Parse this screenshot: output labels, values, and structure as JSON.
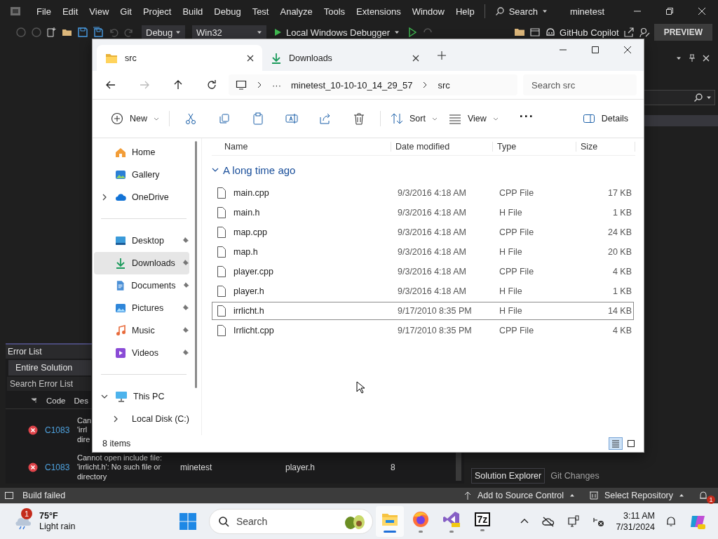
{
  "vs": {
    "menu": [
      "File",
      "Edit",
      "View",
      "Git",
      "Project",
      "Build",
      "Debug",
      "Test",
      "Analyze",
      "Tools",
      "Extensions",
      "Window",
      "Help"
    ],
    "search": "Search",
    "solution_name": "minetest",
    "toolbar": {
      "configuration": "Debug",
      "platform": "Win32",
      "debugger": "Local Windows Debugger",
      "copilot": "GitHub Copilot",
      "preview": "PREVIEW"
    },
    "error_list": {
      "title": "Error List",
      "scope": "Entire Solution",
      "search_placeholder": "Search Error List",
      "columns": [
        "Code",
        "Des"
      ],
      "rows": [
        {
          "code": "C1083",
          "description": "Can\n'irrl\ndire"
        },
        {
          "code": "C1083",
          "description": "Cannot open include file:\n'irrlicht.h': No such file or\ndirectory",
          "project": "minetest",
          "file": "player.h",
          "line": "8"
        }
      ]
    },
    "side_tabs": [
      {
        "label": "Solution Explorer",
        "selected": true
      },
      {
        "label": "Git Changes",
        "selected": false
      }
    ],
    "status_bar": {
      "build": "Build failed",
      "source_control": "Add to Source Control",
      "repository": "Select Repository",
      "notifications": "1"
    }
  },
  "explorer": {
    "tabs": [
      {
        "label": "src",
        "kind": "folder",
        "selected": true
      },
      {
        "label": "Downloads",
        "kind": "download",
        "selected": false
      }
    ],
    "address": {
      "overflow": "···",
      "segments": [
        "minetest_10-10-10_14_29_57",
        "src"
      ]
    },
    "search_placeholder": "Search src",
    "commands": {
      "new": "New",
      "sort": "Sort",
      "view": "View",
      "more": "···",
      "details": "Details"
    },
    "nav_groups": [
      [
        {
          "label": "Home",
          "kind": "home",
          "selected": false
        },
        {
          "label": "Gallery",
          "kind": "gallery",
          "selected": false
        },
        {
          "label": "OneDrive",
          "kind": "cloud",
          "selected": false,
          "expanded": false
        }
      ],
      [
        {
          "label": "Desktop",
          "kind": "desktop",
          "selected": false,
          "pinned": true
        },
        {
          "label": "Downloads",
          "kind": "download",
          "selected": true,
          "pinned": true
        },
        {
          "label": "Documents",
          "kind": "documents",
          "selected": false,
          "pinned": true
        },
        {
          "label": "Pictures",
          "kind": "pictures",
          "selected": false,
          "pinned": true
        },
        {
          "label": "Music",
          "kind": "music",
          "selected": false,
          "pinned": true
        },
        {
          "label": "Videos",
          "kind": "videos",
          "selected": false,
          "pinned": true
        }
      ],
      [
        {
          "label": "This PC",
          "kind": "pc",
          "selected": false,
          "expanded": true,
          "children": [
            {
              "label": "Local Disk (C:)",
              "kind": "disk",
              "selected": false,
              "expanded": false
            }
          ]
        }
      ]
    ],
    "columns": [
      "Name",
      "Date modified",
      "Type",
      "Size"
    ],
    "group": {
      "label": "A long time ago",
      "expanded": true
    },
    "files": [
      {
        "name": "main.cpp",
        "date": "9/3/2016 4:18 AM",
        "type": "CPP File",
        "size": "17 KB",
        "focused": false
      },
      {
        "name": "main.h",
        "date": "9/3/2016 4:18 AM",
        "type": "H File",
        "size": "1 KB",
        "focused": false
      },
      {
        "name": "map.cpp",
        "date": "9/3/2016 4:18 AM",
        "type": "CPP File",
        "size": "24 KB",
        "focused": false
      },
      {
        "name": "map.h",
        "date": "9/3/2016 4:18 AM",
        "type": "H File",
        "size": "20 KB",
        "focused": false
      },
      {
        "name": "player.cpp",
        "date": "9/3/2016 4:18 AM",
        "type": "CPP File",
        "size": "4 KB",
        "focused": false
      },
      {
        "name": "player.h",
        "date": "9/3/2016 4:18 AM",
        "type": "H File",
        "size": "1 KB",
        "focused": false
      },
      {
        "name": "irrlicht.h",
        "date": "9/17/2010 8:35 PM",
        "type": "H File",
        "size": "14 KB",
        "focused": true
      },
      {
        "name": "Irrlicht.cpp",
        "date": "9/17/2010 8:35 PM",
        "type": "CPP File",
        "size": "4 KB",
        "focused": false
      }
    ],
    "status": "8 items",
    "views": [
      {
        "kind": "details",
        "selected": true
      },
      {
        "kind": "tiles",
        "selected": false
      }
    ]
  },
  "taskbar": {
    "weather": {
      "temp": "75°F",
      "condition": "Light rain",
      "badge": "1"
    },
    "search": "Search",
    "apps": [
      {
        "kind": "explorer",
        "active": true
      },
      {
        "kind": "firefox",
        "active": false
      },
      {
        "kind": "visualstudio",
        "active": false
      },
      {
        "kind": "sevenzip",
        "label": "7z",
        "active": false
      }
    ],
    "clock": {
      "time": "3:11 AM",
      "date": "7/31/2024"
    }
  }
}
